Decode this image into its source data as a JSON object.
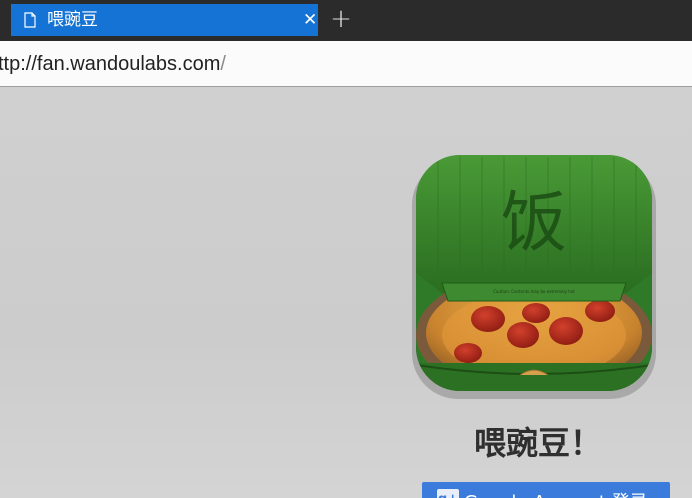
{
  "browser": {
    "tab": {
      "title": "喂豌豆",
      "icon": "page-icon",
      "close_icon": "close-icon"
    },
    "new_tab_icon": "plus-icon",
    "address": {
      "host": "ttp://fan.wandoulabs.com",
      "path": "/"
    },
    "accent_color": "#1473d4"
  },
  "page": {
    "app_icon": {
      "name": "pizza-box-icon",
      "character": "饭",
      "caption": "Caution: Contents may be extremely hot"
    },
    "title": "喂豌豆！",
    "login_button": {
      "label": "Google Account 登录",
      "icon": "google-plus-icon"
    }
  }
}
